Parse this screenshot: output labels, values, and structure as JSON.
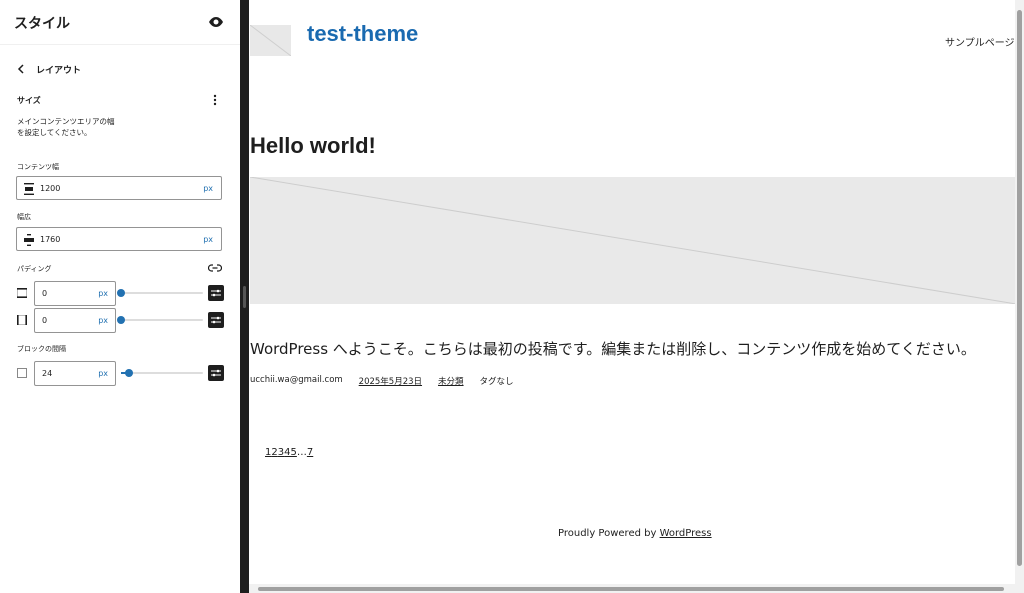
{
  "sidebar": {
    "title": "スタイル",
    "back_label": "レイアウト",
    "section_title": "サイズ",
    "description": "メインコンテンツエリアの幅を設定してください。",
    "content_width": {
      "label": "コンテンツ幅",
      "value": "1200",
      "unit": "px"
    },
    "wide_width": {
      "label": "幅広",
      "value": "1760",
      "unit": "px"
    },
    "padding": {
      "label": "パディング",
      "vertical": {
        "value": "0",
        "unit": "px",
        "slider_fraction": 0.0
      },
      "horizontal": {
        "value": "0",
        "unit": "px",
        "slider_fraction": 0.0
      }
    },
    "block_spacing": {
      "label": "ブロックの間隔",
      "value": "24",
      "unit": "px",
      "slider_fraction": 0.1
    }
  },
  "preview": {
    "site_title": "test-theme",
    "nav_link": "サンプルページ",
    "post_title": "Hello world!",
    "excerpt": "WordPress へようこそ。こちらは最初の投稿です。編集または削除し、コンテンツ作成を始めてください。",
    "meta": {
      "author": "ucchii.wa@gmail.com",
      "date": "2025年5月23日",
      "category": "未分類",
      "tags": "タグなし"
    },
    "pagination": [
      "1",
      "2",
      "3",
      "4",
      "5",
      "…",
      "7"
    ],
    "footer_prefix": "Proudly Powered by ",
    "footer_link": "WordPress"
  },
  "colors": {
    "accent": "#2271b1",
    "site_title": "#1a6ab0",
    "dark": "#1e1e1e"
  }
}
